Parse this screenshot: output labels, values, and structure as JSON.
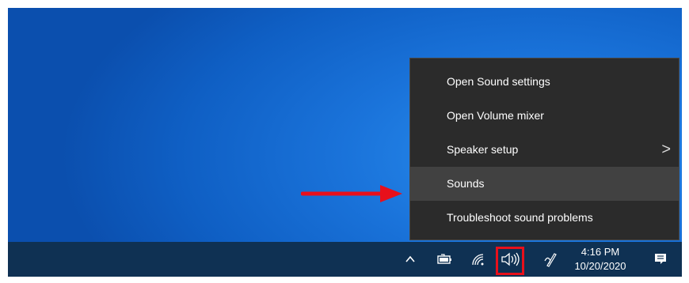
{
  "context_menu": {
    "items": [
      {
        "label": "Open Sound settings"
      },
      {
        "label": "Open Volume mixer"
      },
      {
        "label": "Speaker setup",
        "submenu_arrow": ">"
      },
      {
        "label": "Sounds"
      },
      {
        "label": "Troubleshoot sound problems"
      }
    ],
    "highlighted_item": "Sounds"
  },
  "taskbar": {
    "tray_icons": [
      "chevron-up-icon",
      "battery-icon",
      "wifi-icon",
      "volume-icon",
      "pen-icon",
      "notification-icon"
    ],
    "clock": {
      "time": "4:16 PM",
      "date": "10/20/2020"
    }
  },
  "colors": {
    "menu_background": "#2b2b2b",
    "menu_highlight": "#414141",
    "taskbar": "#0f3153",
    "annotation_red": "#e8101b",
    "desktop_blue": "#1a73da"
  }
}
